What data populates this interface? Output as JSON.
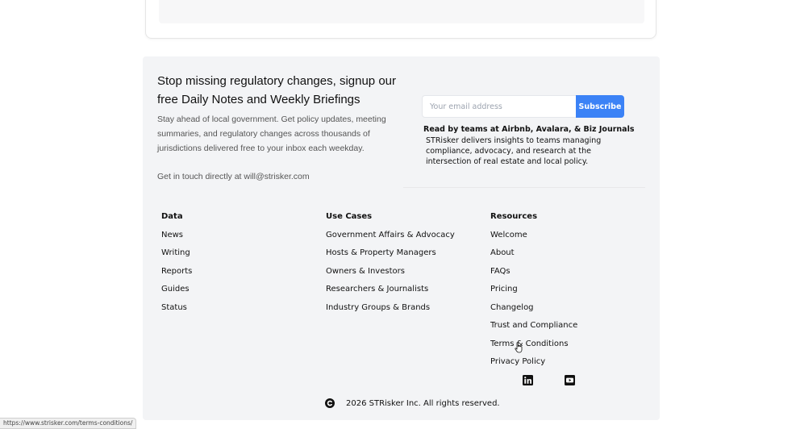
{
  "newsletter": {
    "headline": "Stop missing regulatory changes, signup our free Daily Notes and Weekly Briefings",
    "subtext": "Stay ahead of local government. Get policy updates, meeting summaries, and regulatory changes across thousands of jurisdictions delivered free to your inbox each weekday.",
    "contact": "Get in touch directly at will@strisker.com",
    "email_placeholder": "Your email address",
    "subscribe_label": "Subscribe",
    "readby_title": "Read by teams at Airbnb, Avalara, & Biz Journals",
    "readby_text": "STRisker delivers insights to teams managing compliance, advocacy, and research at the intersection of real estate and local policy."
  },
  "columns": {
    "data": {
      "heading": "Data",
      "links": [
        "News",
        "Writing",
        "Reports",
        "Guides",
        "Status"
      ]
    },
    "use_cases": {
      "heading": "Use Cases",
      "links": [
        "Government Affairs & Advocacy",
        "Hosts & Property Managers",
        "Owners & Investors",
        "Researchers & Journalists",
        "Industry Groups & Brands"
      ]
    },
    "resources": {
      "heading": "Resources",
      "links": [
        "Welcome",
        "About",
        "FAQs",
        "Pricing",
        "Changelog",
        "Trust and Compliance",
        "Terms & Conditions",
        "Privacy Policy"
      ]
    }
  },
  "social": {
    "icons": [
      "linkedin-icon",
      "youtube-icon"
    ]
  },
  "copyright": "2026 STRisker Inc. All rights reserved.",
  "status_bar_url": "https://www.strisker.com/terms-conditions/",
  "colors": {
    "footer_bg": "#f3f4f6",
    "accent": "#3b82f6",
    "text": "#111111",
    "muted": "#555555"
  }
}
